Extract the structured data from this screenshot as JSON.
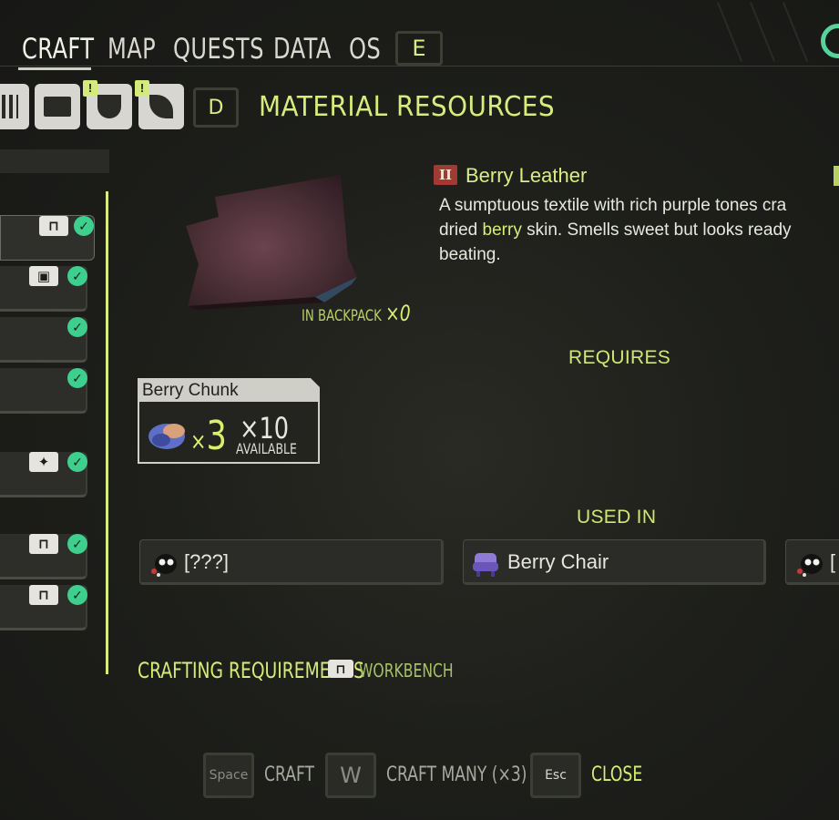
{
  "nav": {
    "tabs": [
      "CRAFT",
      "MAP",
      "QUESTS",
      "DATA",
      "OS"
    ],
    "next_key": "E",
    "prev_key": "D"
  },
  "section": {
    "title": "MATERIAL RESOURCES"
  },
  "item": {
    "tier": "II",
    "name": "Berry Leather",
    "desc_line1": "A sumptuous textile with rich purple tones cra",
    "desc_line2_pre": "dried ",
    "desc_line2_hl": "berry",
    "desc_line2_post": " skin. Smells sweet but looks ready",
    "desc_line3": "beating.",
    "in_backpack_label": "IN BACKPACK",
    "in_backpack_count": "×0"
  },
  "requires": {
    "heading": "REQUIRES",
    "items": [
      {
        "name": "Berry Chunk",
        "have": "3",
        "need": "×10",
        "available_label": "AVAILABLE"
      }
    ]
  },
  "used_in": {
    "heading": "USED IN",
    "items": [
      {
        "label": "[???]",
        "icon": "unknown-creature-icon"
      },
      {
        "label": "Berry Chair",
        "icon": "berry-chair-icon"
      },
      {
        "label": "[",
        "icon": "unknown-creature-icon"
      }
    ]
  },
  "crafting_requirements": {
    "label": "CRAFTING REQUIREMENTS",
    "station": "WORKBENCH"
  },
  "actions": [
    {
      "key": "Space",
      "label": "CRAFT"
    },
    {
      "key": "W",
      "label": "CRAFT MANY (×3)"
    },
    {
      "key": "Esc",
      "label": "CLOSE"
    }
  ],
  "colors": {
    "accent": "#d6ec7c",
    "check": "#3ecf8e",
    "tier_badge": "#a23a33",
    "background": "#1e1f1b"
  }
}
